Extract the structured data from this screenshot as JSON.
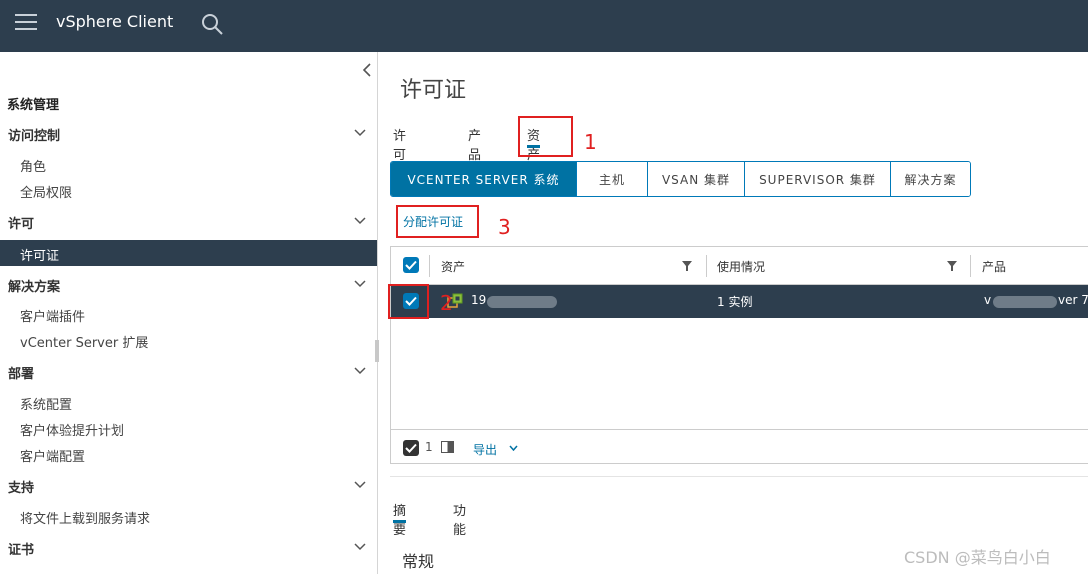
{
  "header": {
    "app_title": "vSphere Client",
    "menu_icon": "hamburger-icon",
    "search_icon": "search-icon"
  },
  "sidebar": {
    "heading": "系统管理",
    "groups": [
      {
        "label": "访问控制",
        "items": [
          "角色",
          "全局权限"
        ]
      },
      {
        "label": "许可",
        "items": [
          "许可证"
        ]
      },
      {
        "label": "解决方案",
        "items": [
          "客户端插件",
          "vCenter Server 扩展"
        ]
      },
      {
        "label": "部署",
        "items": [
          "系统配置",
          "客户体验提升计划",
          "客户端配置"
        ]
      },
      {
        "label": "支持",
        "items": [
          "将文件上载到服务请求"
        ]
      },
      {
        "label": "证书",
        "items": []
      }
    ],
    "active_item": "许可证"
  },
  "main": {
    "page_title": "许可证",
    "tabs": [
      "许可证",
      "产品",
      "资产"
    ],
    "active_tab": "资产",
    "segments": [
      "VCENTER SERVER 系统",
      "主机",
      "VSAN 集群",
      "SUPERVISOR 集群",
      "解决方案"
    ],
    "active_segment": "VCENTER SERVER 系统",
    "assign_button": "分配许可证",
    "annotations": [
      "1",
      "2",
      "3"
    ],
    "grid": {
      "columns": [
        "资产",
        "使用情况",
        "产品"
      ],
      "rows": [
        {
          "asset": "19",
          "usage": "1 实例",
          "product_start": "v",
          "product_end": "ver 7",
          "selected": true
        }
      ],
      "selected_count": "1",
      "export_label": "导出"
    },
    "detail_tabs": [
      "摘要",
      "功能"
    ],
    "active_detail_tab": "摘要",
    "section_title": "常规"
  },
  "watermark": "CSDN @菜鸟白小白",
  "colors": {
    "header_bg": "#2d3e4e",
    "accent": "#0072a3",
    "annotation": "#e02020"
  }
}
